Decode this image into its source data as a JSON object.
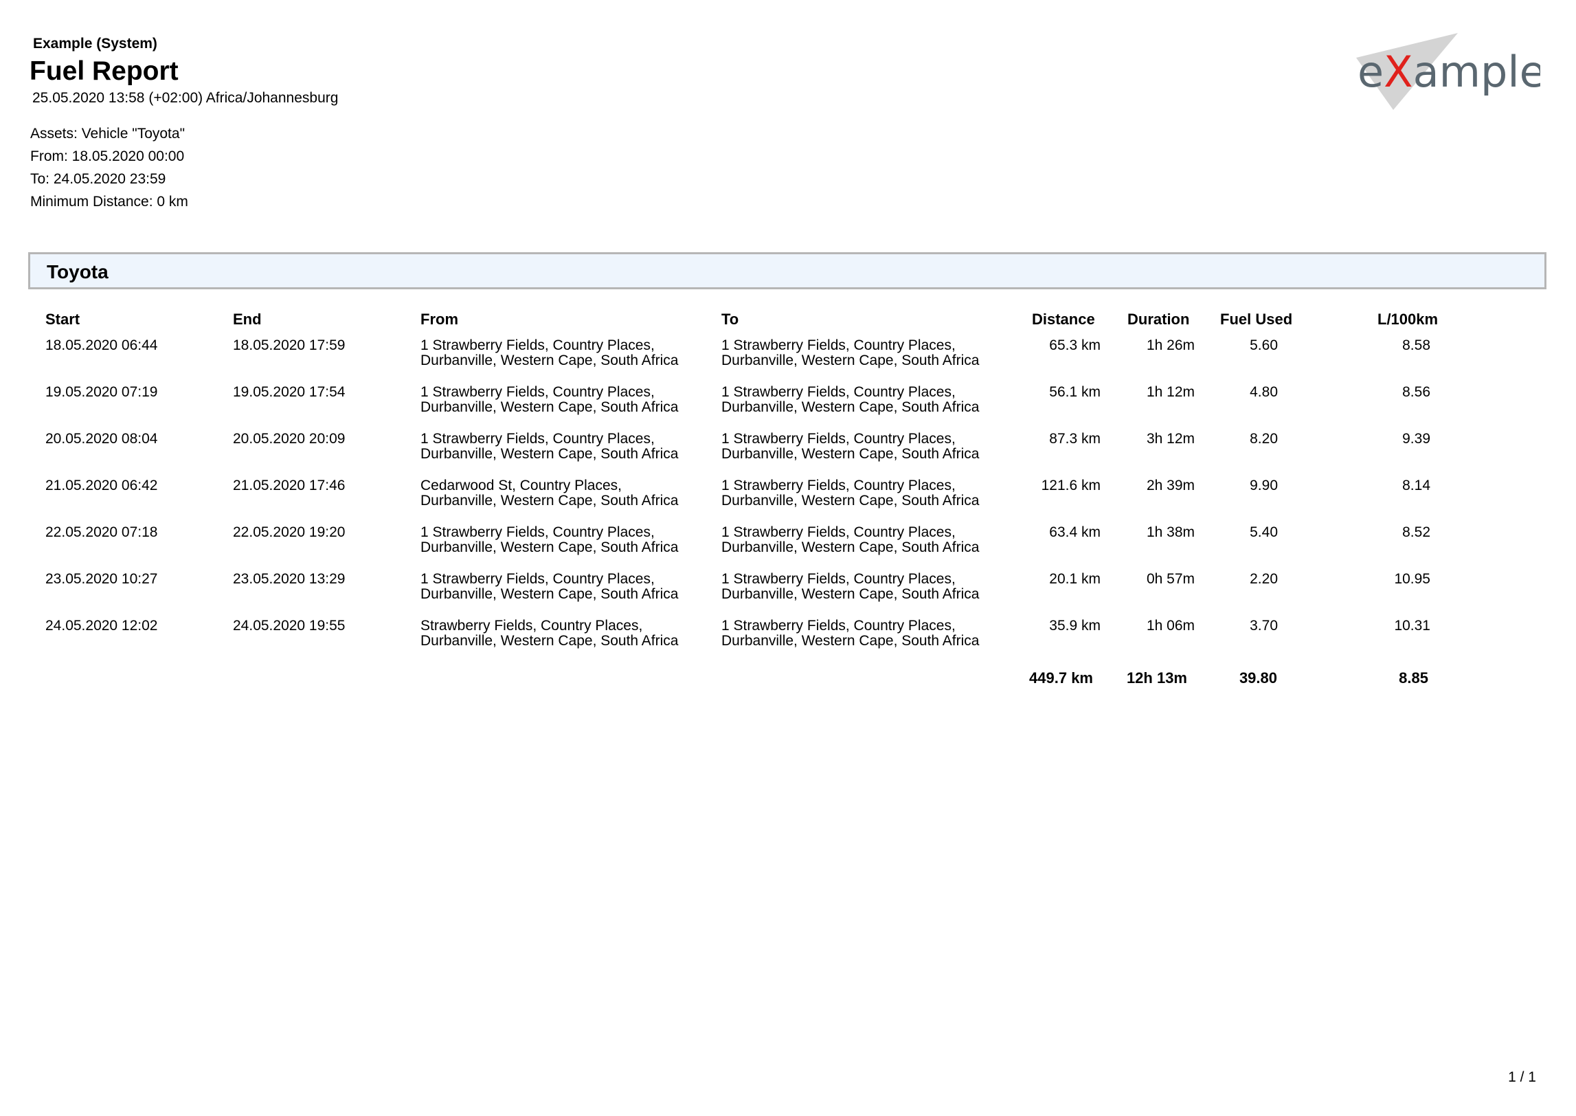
{
  "header": {
    "org_name": "Example (System)",
    "title": "Fuel Report",
    "generated": "25.05.2020 13:58 (+02:00) Africa/Johannesburg"
  },
  "logo": {
    "text_pre": "e",
    "text_x": "X",
    "text_post": "ample",
    "text_color": "#5a6770",
    "accent_color": "#e0211c"
  },
  "params": {
    "assets": "Assets: Vehicle \"Toyota\"",
    "from": "From: 18.05.2020 00:00",
    "to": "To: 24.05.2020 23:59",
    "min_distance": "Minimum Distance: 0 km"
  },
  "section": {
    "title": "Toyota"
  },
  "table": {
    "headers": {
      "start": "Start",
      "end": "End",
      "from": "From",
      "to": "To",
      "distance": "Distance",
      "duration": "Duration",
      "fuel_used": "Fuel Used",
      "l_per_100km": "L/100km"
    },
    "rows": [
      {
        "start": "18.05.2020 06:44",
        "end": "18.05.2020 17:59",
        "from": "1 Strawberry Fields, Country Places, Durbanville, Western Cape, South Africa",
        "to": "1 Strawberry Fields, Country Places, Durbanville, Western Cape, South Africa",
        "distance": "65.3 km",
        "duration": "1h 26m",
        "fuel_used": "5.60",
        "l_per_100km": "8.58"
      },
      {
        "start": "19.05.2020 07:19",
        "end": "19.05.2020 17:54",
        "from": "1 Strawberry Fields, Country Places, Durbanville, Western Cape, South Africa",
        "to": "1 Strawberry Fields, Country Places, Durbanville, Western Cape, South Africa",
        "distance": "56.1 km",
        "duration": "1h 12m",
        "fuel_used": "4.80",
        "l_per_100km": "8.56"
      },
      {
        "start": "20.05.2020 08:04",
        "end": "20.05.2020 20:09",
        "from": "1 Strawberry Fields, Country Places, Durbanville, Western Cape, South Africa",
        "to": "1 Strawberry Fields, Country Places, Durbanville, Western Cape, South Africa",
        "distance": "87.3 km",
        "duration": "3h 12m",
        "fuel_used": "8.20",
        "l_per_100km": "9.39"
      },
      {
        "start": "21.05.2020 06:42",
        "end": "21.05.2020 17:46",
        "from": "Cedarwood St, Country Places, Durbanville, Western Cape, South Africa",
        "to": "1 Strawberry Fields, Country Places, Durbanville, Western Cape, South Africa",
        "distance": "121.6 km",
        "duration": "2h 39m",
        "fuel_used": "9.90",
        "l_per_100km": "8.14"
      },
      {
        "start": "22.05.2020 07:18",
        "end": "22.05.2020 19:20",
        "from": "1 Strawberry Fields, Country Places, Durbanville, Western Cape, South Africa",
        "to": "1 Strawberry Fields, Country Places, Durbanville, Western Cape, South Africa",
        "distance": "63.4 km",
        "duration": "1h 38m",
        "fuel_used": "5.40",
        "l_per_100km": "8.52"
      },
      {
        "start": "23.05.2020 10:27",
        "end": "23.05.2020 13:29",
        "from": "1 Strawberry Fields, Country Places, Durbanville, Western Cape, South Africa",
        "to": "1 Strawberry Fields, Country Places, Durbanville, Western Cape, South Africa",
        "distance": "20.1 km",
        "duration": "0h 57m",
        "fuel_used": "2.20",
        "l_per_100km": "10.95"
      },
      {
        "start": "24.05.2020 12:02",
        "end": "24.05.2020 19:55",
        "from": "Strawberry Fields, Country Places, Durbanville, Western Cape, South Africa",
        "to": "1 Strawberry Fields, Country Places, Durbanville, Western Cape, South Africa",
        "distance": "35.9 km",
        "duration": "1h 06m",
        "fuel_used": "3.70",
        "l_per_100km": "10.31"
      }
    ],
    "totals": {
      "distance": "449.7 km",
      "duration": "12h 13m",
      "fuel_used": "39.80",
      "l_per_100km": "8.85"
    }
  },
  "footer": {
    "page": "1 / 1"
  }
}
